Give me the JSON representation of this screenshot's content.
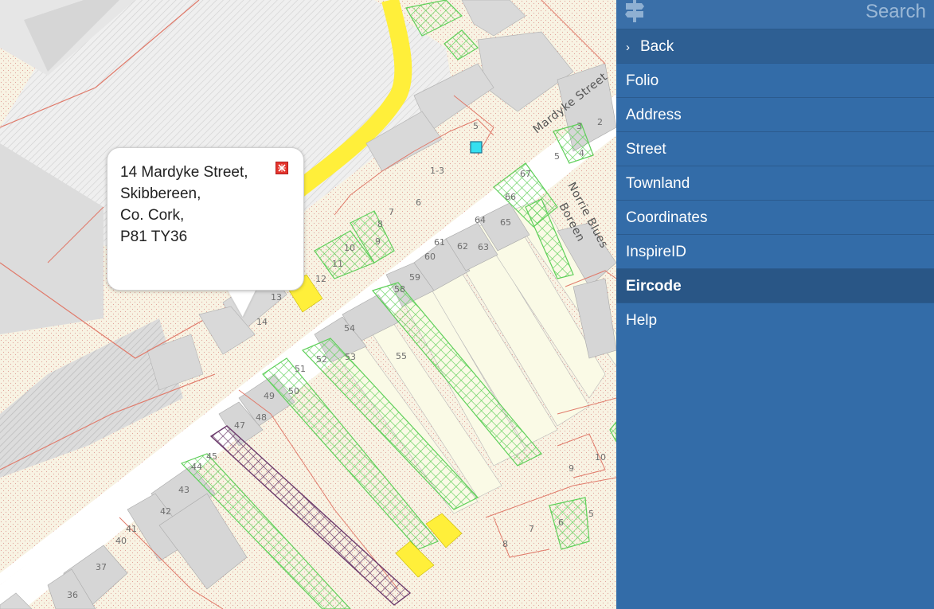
{
  "popup": {
    "address_lines": [
      "14 Mardyke Street,",
      "Skibbereen,",
      "Co. Cork,",
      "P81 TY36"
    ]
  },
  "panel": {
    "search_placeholder": "Search",
    "back_label": "Back",
    "items": [
      "Folio",
      "Address",
      "Street",
      "Townland",
      "Coordinates",
      "InspireID",
      "Eircode",
      "Help"
    ],
    "active_item": "Eircode"
  },
  "map": {
    "street_labels": [
      "Mardyke Street",
      "Norrie Blues Boreen"
    ],
    "plot_numbers": [
      "1-3",
      "2",
      "3",
      "4",
      "5",
      "5",
      "6",
      "7",
      "8",
      "9",
      "10",
      "11",
      "12",
      "13",
      "14",
      "36",
      "37",
      "40",
      "41",
      "42",
      "43",
      "44",
      "45",
      "47",
      "48",
      "49",
      "50",
      "51",
      "52",
      "53",
      "54",
      "55",
      "58",
      "59",
      "60",
      "61",
      "62",
      "63",
      "64",
      "65",
      "66",
      "67",
      "9",
      "10",
      "8",
      "7",
      "6",
      "5"
    ]
  },
  "colors": {
    "panel_bg": "#336ca8",
    "active_bg": "#295686",
    "road_yellow": "#ffef3a",
    "plot_green": "#54c94a",
    "plot_purple": "#6b3a6b",
    "parcel_red": "#e07a6a"
  }
}
